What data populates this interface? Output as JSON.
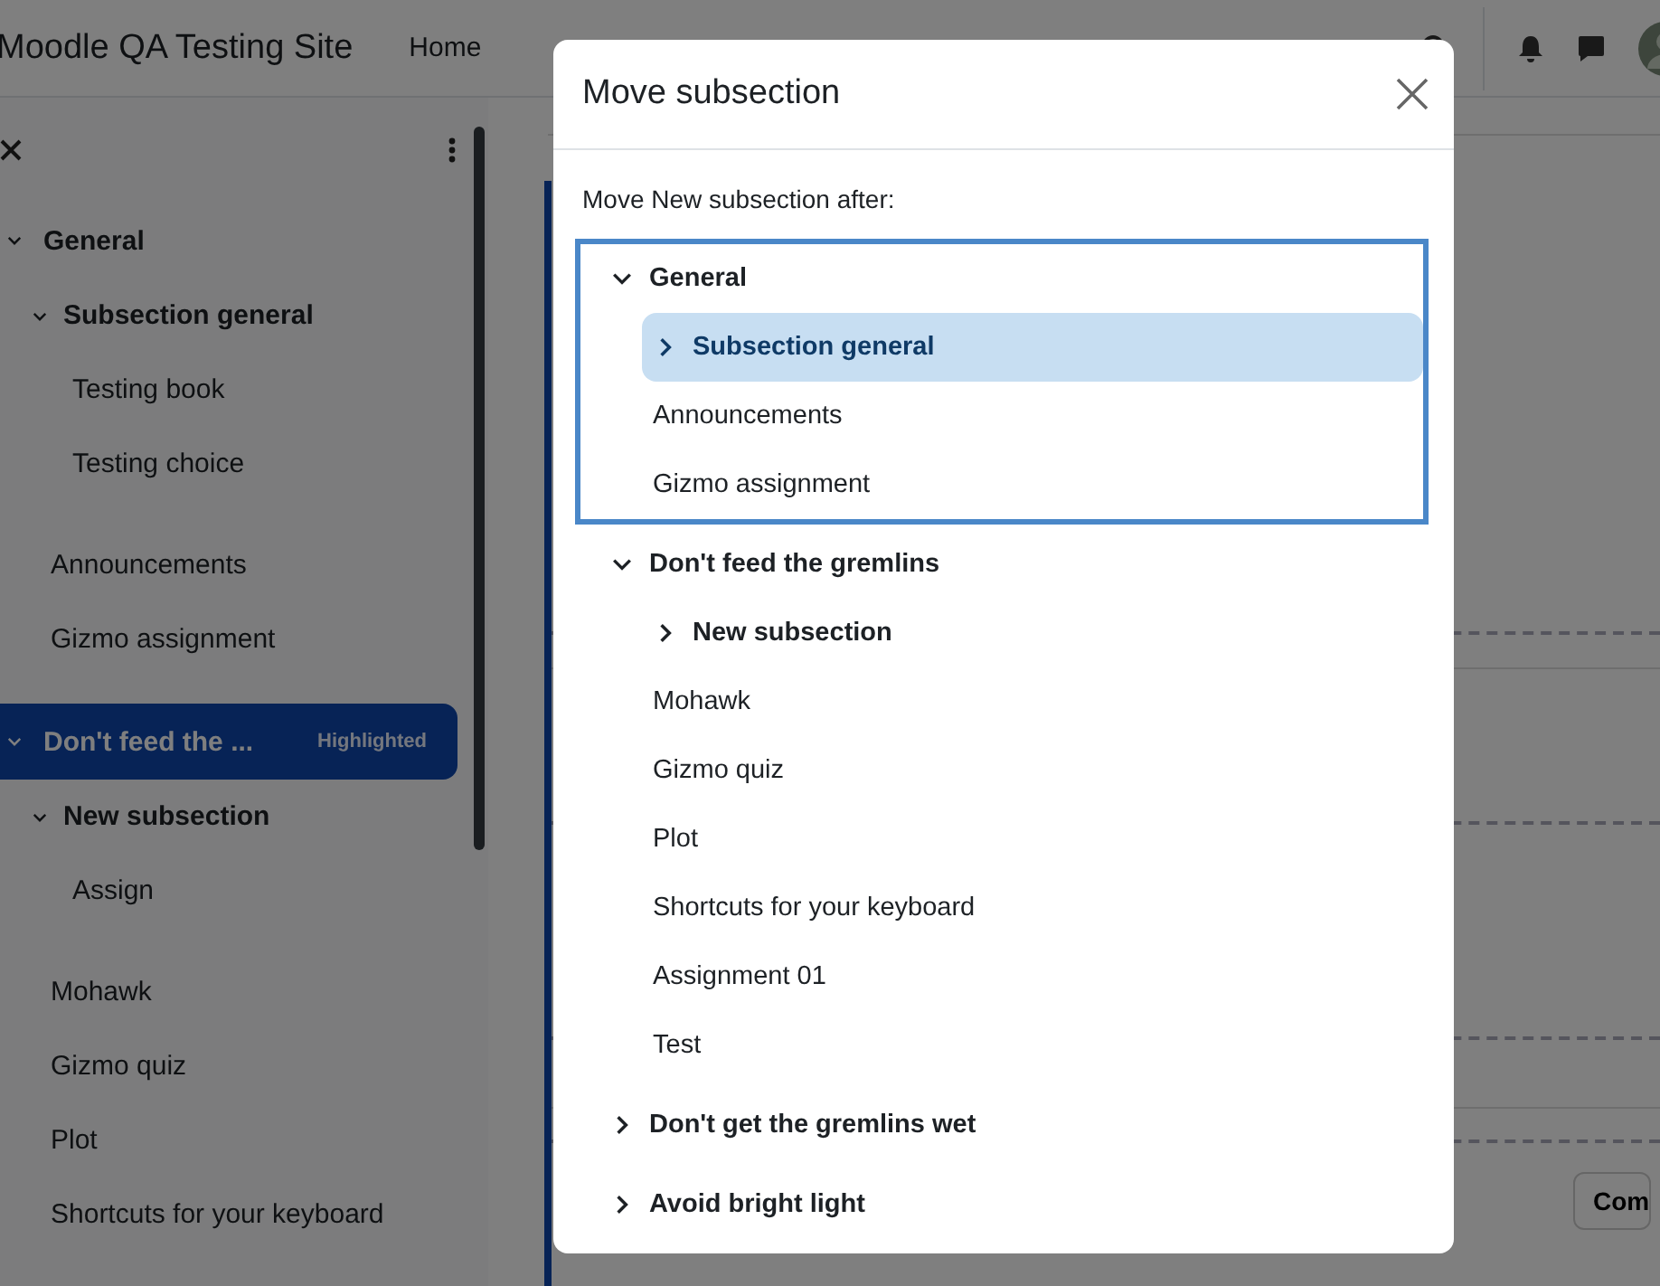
{
  "header": {
    "site_name": "Moodle QA Testing Site",
    "nav": [
      {
        "label": "Home"
      }
    ]
  },
  "course_index": {
    "sections": [
      {
        "title": "General",
        "selected": false,
        "expanded": true,
        "children": [
          {
            "kind": "subsection",
            "title": "Subsection general",
            "expanded": true,
            "children": [
              {
                "title": "Testing book"
              },
              {
                "title": "Testing choice"
              }
            ]
          },
          {
            "kind": "activity",
            "title": "Announcements"
          },
          {
            "kind": "activity",
            "title": "Gizmo assignment"
          }
        ]
      },
      {
        "title": "Don't feed the ...",
        "badge": "Highlighted",
        "selected": true,
        "expanded": true,
        "children": [
          {
            "kind": "subsection",
            "title": "New subsection",
            "expanded": true,
            "children": [
              {
                "title": "Assign"
              }
            ]
          },
          {
            "kind": "activity",
            "title": "Mohawk"
          },
          {
            "kind": "activity",
            "title": "Gizmo quiz"
          },
          {
            "kind": "activity",
            "title": "Plot"
          },
          {
            "kind": "activity",
            "title": "Shortcuts for your keyboard"
          }
        ]
      }
    ]
  },
  "content": {
    "button": "Com"
  },
  "modal": {
    "title": "Move subsection",
    "prompt": "Move New subsection after:",
    "tree": [
      {
        "kind": "section",
        "title": "General",
        "expanded": true,
        "focused": true,
        "children": [
          {
            "kind": "subsection",
            "title": "Subsection general",
            "expanded": false,
            "selected": true
          },
          {
            "kind": "activity",
            "title": "Announcements"
          },
          {
            "kind": "activity",
            "title": "Gizmo assignment"
          }
        ]
      },
      {
        "kind": "section",
        "title": "Don't feed the gremlins",
        "expanded": true,
        "focused": false,
        "children": [
          {
            "kind": "subsection",
            "title": "New subsection",
            "expanded": false,
            "selected": false
          },
          {
            "kind": "activity",
            "title": "Mohawk"
          },
          {
            "kind": "activity",
            "title": "Gizmo quiz"
          },
          {
            "kind": "activity",
            "title": "Plot"
          },
          {
            "kind": "activity",
            "title": "Shortcuts for your keyboard"
          },
          {
            "kind": "activity",
            "title": "Assignment 01"
          },
          {
            "kind": "activity",
            "title": "Test"
          }
        ]
      },
      {
        "kind": "section",
        "title": "Don't get the gremlins wet",
        "expanded": false,
        "focused": false
      },
      {
        "kind": "section",
        "title": "Avoid bright light",
        "expanded": false,
        "focused": false
      }
    ]
  }
}
